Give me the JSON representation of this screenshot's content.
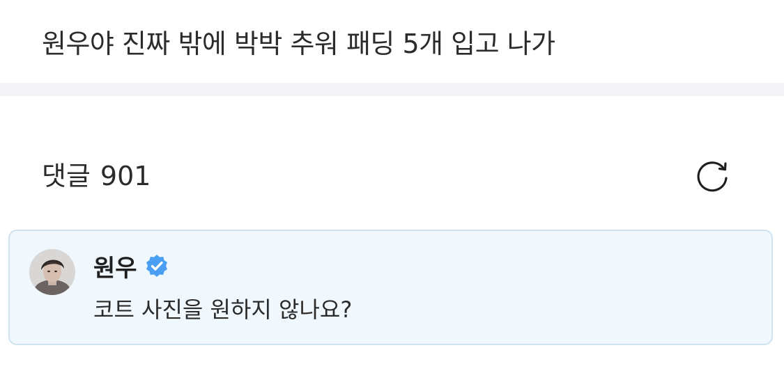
{
  "post": {
    "title": "원우야 진짜 밖에 박박 추워 패딩 5개 입고 나가"
  },
  "comments": {
    "label": "댓글",
    "count": "901",
    "refresh_icon": "refresh-icon"
  },
  "pinned_comment": {
    "author": "원우",
    "verified_icon": "verified-badge-icon",
    "text": "코트 사진을 원하지 않나요?",
    "colors": {
      "background": "#f0f8fd",
      "border": "#cfe3ef",
      "badge": "#4a9ff5"
    }
  }
}
